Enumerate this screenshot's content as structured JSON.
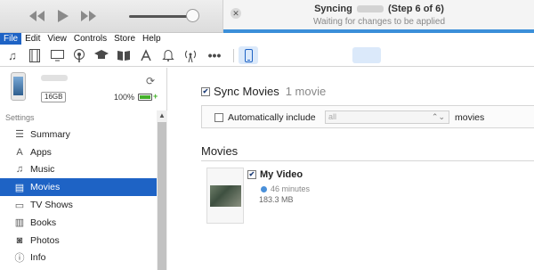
{
  "player": {
    "controls": [
      "rewind-icon",
      "play-icon",
      "fast-forward-icon"
    ],
    "volume_level": 0.9
  },
  "status": {
    "line1_prefix": "Syncing",
    "line1_suffix": "(Step 6 of 6)",
    "line2": "Waiting for changes to be applied",
    "progress": 1.0,
    "accent": "#3b8fd9"
  },
  "menu": {
    "items": [
      "File",
      "Edit",
      "View",
      "Controls",
      "Store",
      "Help"
    ]
  },
  "toolbar": {
    "icons": [
      "music-note-icon",
      "film-icon",
      "tv-icon",
      "podcast-icon",
      "graduation-cap-icon",
      "book-icon",
      "app-store-icon",
      "bell-icon",
      "antenna-icon",
      "more-icon"
    ],
    "device_icon": "iphone-icon"
  },
  "device": {
    "capacity": "16GB",
    "battery": "100%",
    "battery_level": 1.0
  },
  "sidebar": {
    "section_label": "Settings",
    "items": [
      {
        "label": "Summary",
        "icon": "summary-icon",
        "glyph": "☰"
      },
      {
        "label": "Apps",
        "icon": "apps-icon",
        "glyph": "A"
      },
      {
        "label": "Music",
        "icon": "music-icon",
        "glyph": "♫"
      },
      {
        "label": "Movies",
        "icon": "movies-icon",
        "glyph": "▤"
      },
      {
        "label": "TV Shows",
        "icon": "tv-icon",
        "glyph": "▭"
      },
      {
        "label": "Books",
        "icon": "books-icon",
        "glyph": "▥"
      },
      {
        "label": "Photos",
        "icon": "photos-icon",
        "glyph": "◙"
      },
      {
        "label": "Info",
        "icon": "info-icon",
        "glyph": "ⓘ"
      }
    ],
    "selected_index": 3,
    "selection_color": "#1e63c5"
  },
  "main": {
    "sync_checked": true,
    "sync_title": "Sync Movies",
    "sync_count": "1 movie",
    "auto_checked": false,
    "auto_label": "Automatically include",
    "auto_value": "all",
    "auto_suffix": "movies",
    "movies_heading": "Movies",
    "movie": {
      "checked": true,
      "title": "My Video",
      "duration": "46 minutes",
      "size": "183.3 MB"
    }
  }
}
